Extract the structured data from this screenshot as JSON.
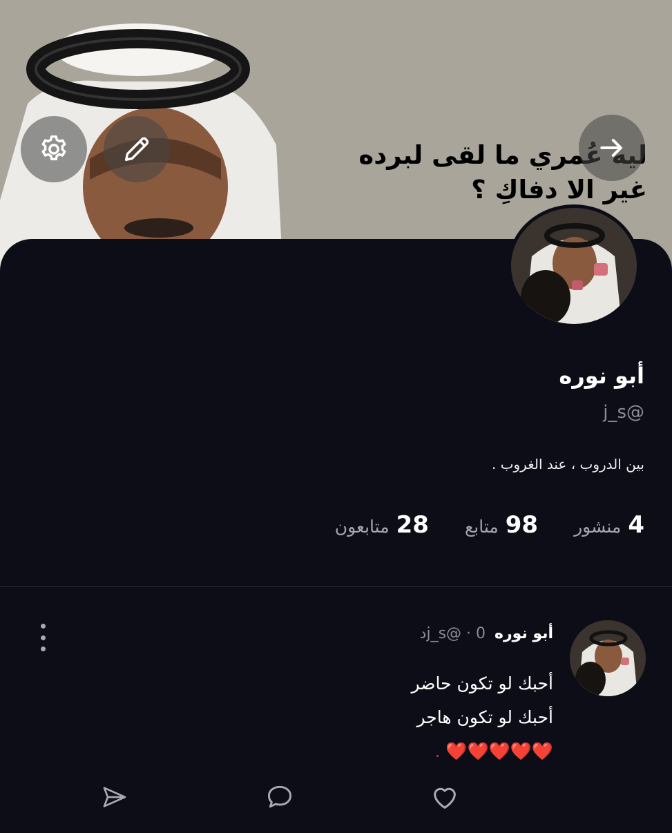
{
  "cover": {
    "quote_line1": "ليه عُمري ما لقى لبرده",
    "quote_line2": "غير الا دفاكِ ؟"
  },
  "profile": {
    "name": "أبو نوره",
    "handle": "j_s@",
    "bio": "بين الدروب ، عند الغروب ."
  },
  "stats": [
    {
      "num": "28",
      "label": "متابعون"
    },
    {
      "num": "98",
      "label": "متابع"
    },
    {
      "num": "4",
      "label": "منشور"
    }
  ],
  "post": {
    "author": "أبو نوره",
    "meta": "j_s@ · 0د",
    "lines": [
      "أحبك لو تكون حاضر",
      "أحبك لو تكون هاجر"
    ],
    "hearts": "❤️❤️❤️❤️❤️ ."
  },
  "icons": {
    "settings": "gear-icon",
    "edit": "pencil-icon",
    "back": "arrow-right-icon",
    "share": "send-icon",
    "comment": "comment-icon",
    "like": "heart-icon",
    "more": "more-vertical-icon"
  },
  "colors": {
    "background": "#0d0d18",
    "cover": "#a9a59a",
    "muted_text": "#a4a4ae",
    "heart": "#e0262e"
  }
}
